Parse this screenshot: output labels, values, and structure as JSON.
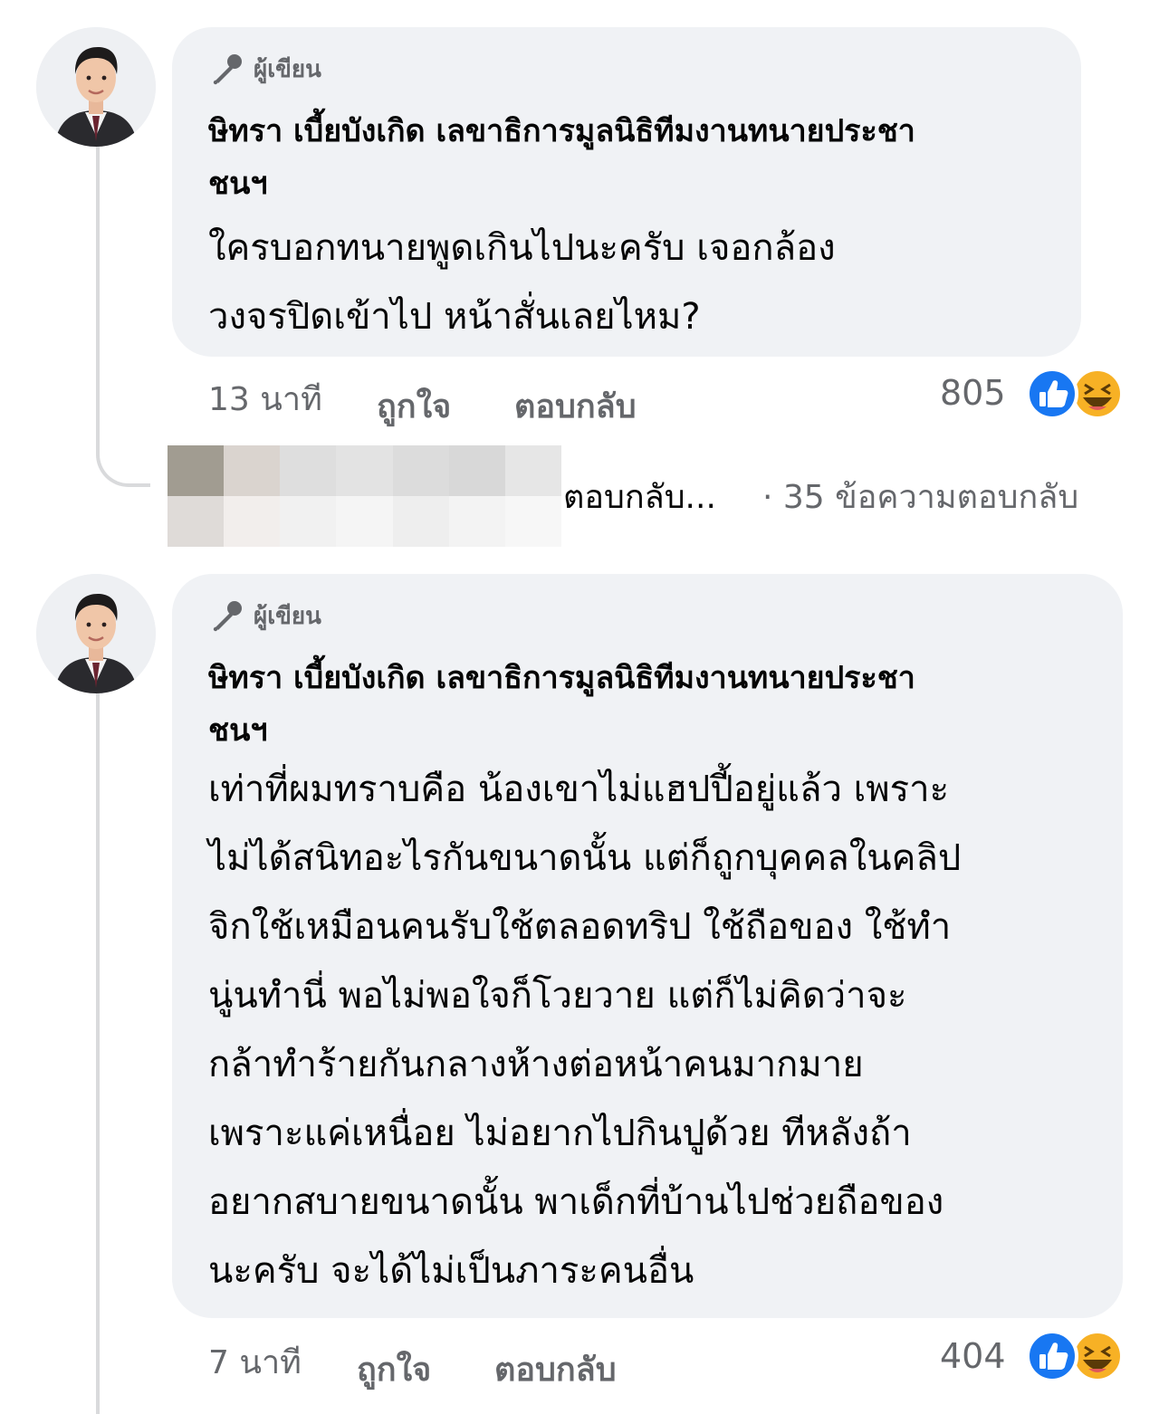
{
  "comments": [
    {
      "author_badge": "ผู้เขียน",
      "author_name_line1": "ษิทรา เบี้ยบังเกิด เลขาธิการมูลนิธิทีมงานทนายประชา",
      "author_name_line2": "ชนฯ",
      "body_lines": [
        "ใครบอกทนายพูดเกินไปนะครับ เจอกล้อง",
        "วงจรปิดเข้าไป หน้าสั่นเลยไหม?"
      ],
      "time": "13 นาที",
      "like_label": "ถูกใจ",
      "reply_label": "ตอบกลับ",
      "reaction_count": "805",
      "reactions": [
        "like-icon",
        "haha-icon"
      ]
    },
    {
      "author_badge": "ผู้เขียน",
      "author_name_line1": "ษิทรา เบี้ยบังเกิด เลขาธิการมูลนิธิทีมงานทนายประชา",
      "author_name_line2": "ชนฯ",
      "body_lines": [
        "เท่าที่ผมทราบคือ น้องเขาไม่แฮปปี้อยู่แล้ว เพราะ",
        "ไม่ได้สนิทอะไรกันขนาดนั้น แต่ก็ถูกบุคคลในคลิป",
        "จิกใช้เหมือนคนรับใช้ตลอดทริป ใช้ถือของ ใช้ทำ",
        "นู่นทำนี่ พอไม่พอใจก็โวยวาย แต่ก็ไม่คิดว่าจะ",
        "กล้าทำร้ายกันกลางห้างต่อหน้าคนมากมาย",
        "เพราะแค่เหนื่อย ไม่อยากไปกินปูด้วย ทีหลังถ้า",
        "อยากสบายขนาดนั้น พาเด็กที่บ้านไปช่วยถือของ",
        "นะครับ จะได้ไม่เป็นภาระคนอื่น"
      ],
      "time": "7 นาที",
      "like_label": "ถูกใจ",
      "reply_label": "ตอบกลับ",
      "reaction_count": "404",
      "reactions": [
        "like-icon",
        "haha-icon"
      ]
    }
  ],
  "replies_preview": {
    "reply_text": "ตอบกลับ...",
    "reply_count_text": "· 35 ข้อความตอบกลับ"
  },
  "colors": {
    "bubble": "#f0f2f5",
    "secondary_text": "#65676b",
    "like_blue": "#1877f2",
    "haha_yellow": "#f7b125"
  }
}
